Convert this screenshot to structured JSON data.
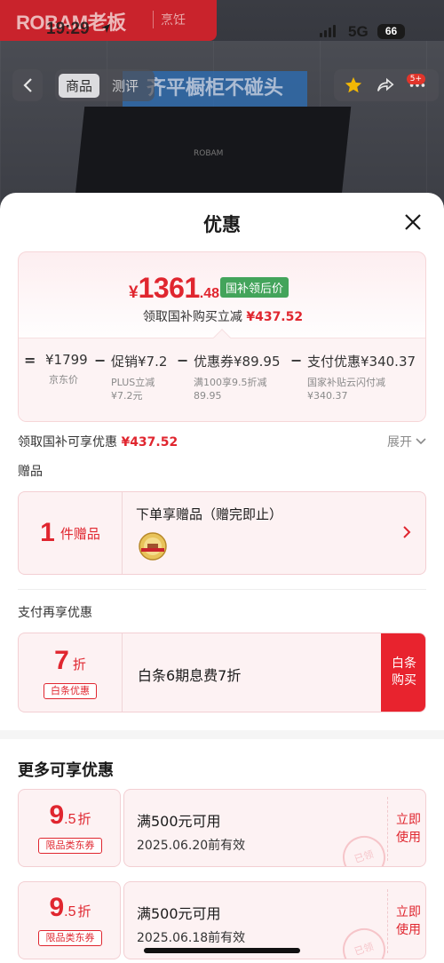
{
  "background": {
    "brand": "ROBAM老板",
    "slogan": "烹饪",
    "hood_headline": "齐平橱柜不碰头",
    "hood_logo": "ROBAM"
  },
  "status_bar": {
    "time": "19:29",
    "network": "5G",
    "battery": "66"
  },
  "nav": {
    "tabs": [
      {
        "label": "商品",
        "active": true
      },
      {
        "label": "测评",
        "active": false
      }
    ],
    "badge": "5+"
  },
  "sheet": {
    "title": "优惠"
  },
  "price_card": {
    "currency": "¥",
    "price_int": "1361",
    "price_dec": ".48",
    "price_tag": "国补领后价",
    "subtitle_prefix": "领取国补购买立减",
    "subtitle_amount": "¥437.52",
    "formula": [
      {
        "op": "=",
        "main": "¥1799",
        "note1": "京东价",
        "note2": ""
      },
      {
        "op": "−",
        "main": "促销¥7.2",
        "note1": "PLUS立减",
        "note2": "¥7.2元"
      },
      {
        "op": "−",
        "main": "优惠券¥89.95",
        "note1": "满100享9.5折减",
        "note2": "89.95"
      },
      {
        "op": "−",
        "main": "支付优惠¥340.37",
        "note1": "国家补贴云闪付减",
        "note2": "¥340.37"
      }
    ]
  },
  "claim_row": {
    "label": "领取国补可享优惠",
    "amount": "¥437.52",
    "expand": "展开"
  },
  "gifts": {
    "section_label": "赠品",
    "count": "1",
    "unit": "件赠品",
    "title": "下单享赠品（赠完即止）",
    "thumb_icon": "gift-badge-icon"
  },
  "payment": {
    "section_label": "支付再享优惠",
    "discount": "7",
    "discount_unit": "折",
    "tag": "白条优惠",
    "text": "白条6期息费7折",
    "button": "白条购买"
  },
  "more": {
    "title": "更多可享优惠",
    "coupons": [
      {
        "rate_big": "9",
        "rate_small": ".5",
        "rate_unit": "折",
        "tag": "限品类东券",
        "title": "满500元可用",
        "date": "2025.06.20前有效",
        "stamp": "已领",
        "button": "立即使用"
      },
      {
        "rate_big": "9",
        "rate_small": ".5",
        "rate_unit": "折",
        "tag": "限品类东券",
        "title": "满500元可用",
        "date": "2025.06.18前有效",
        "stamp": "已领",
        "button": "立即使用"
      }
    ]
  },
  "colors": {
    "accent_red": "#e0262f",
    "tag_green": "#43a45b",
    "card_pink": "#fdf2f3"
  }
}
